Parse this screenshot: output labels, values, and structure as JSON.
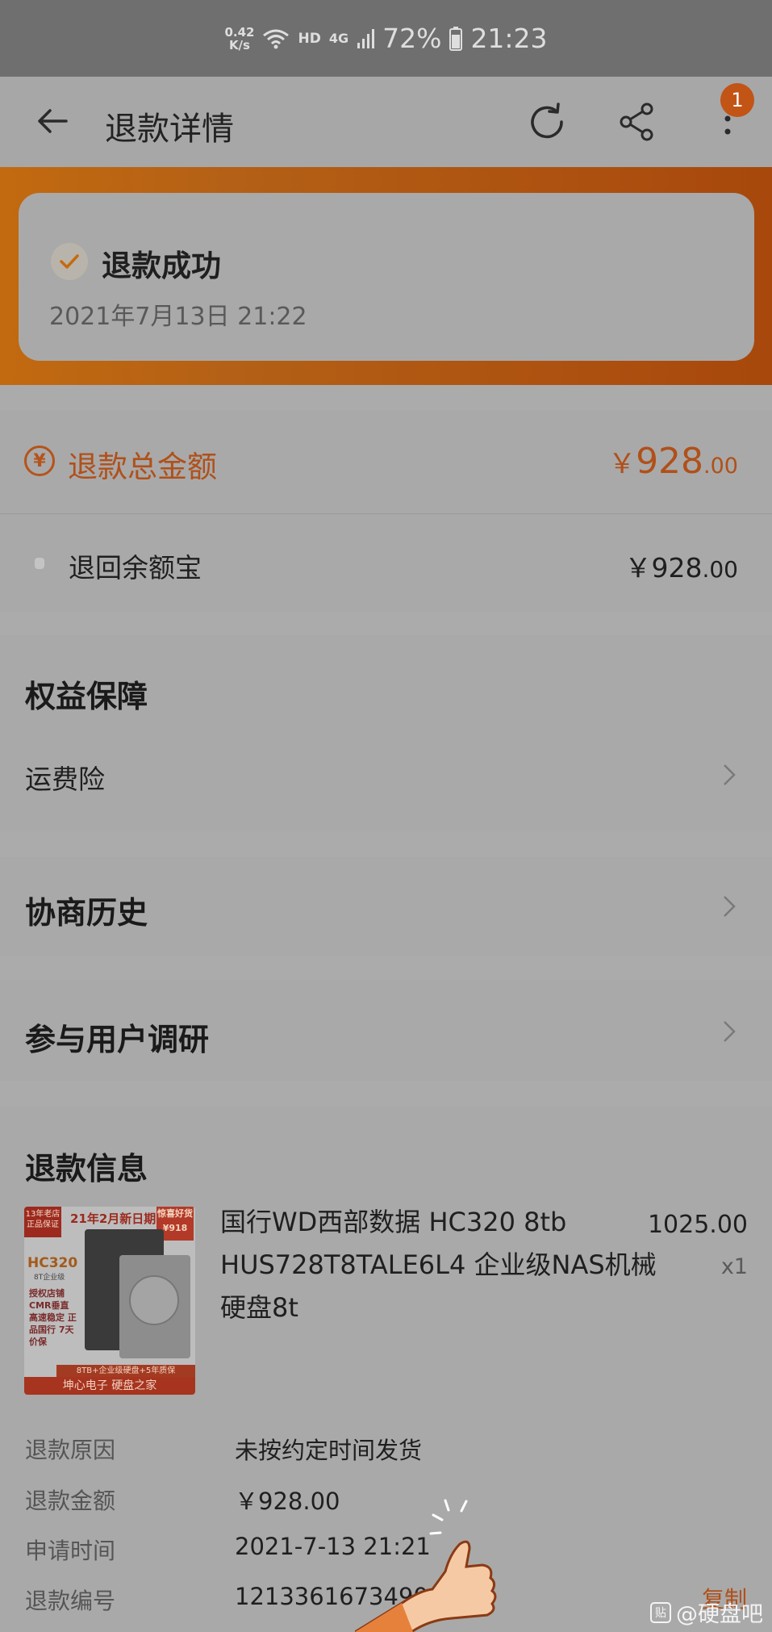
{
  "status_bar": {
    "speed_value": "0.42",
    "speed_unit": "K/s",
    "hd": "HD",
    "network": "4G",
    "battery": "72%",
    "time": "21:23"
  },
  "header": {
    "title": "退款详情",
    "notification_count": "1"
  },
  "status_card": {
    "status": "退款成功",
    "time": "2021年7月13日 21:22"
  },
  "refund_total": {
    "icon_glyph": "¥",
    "label": "退款总金额",
    "currency": "￥",
    "amount_int": "928",
    "amount_dec": ".00"
  },
  "refund_destination": {
    "label": "退回余额宝",
    "amount_main": "￥928",
    "amount_dec": ".00"
  },
  "benefits": {
    "title": "权益保障",
    "item": "运费险"
  },
  "negotiation_history": {
    "title": "协商历史"
  },
  "user_survey": {
    "title": "参与用户调研"
  },
  "refund_info": {
    "title": "退款信息",
    "product": {
      "title": "国行WD西部数据 HC320 8tb HUS728T8TALE6L4 企业级NAS机械硬盘8t",
      "price": "1025.00",
      "qty": "x1",
      "image": {
        "tag_store": "13年老店 正品保证",
        "new_date": "21年2月新日期",
        "price_label": "惊喜好货",
        "price": "¥918",
        "model": "HC320",
        "subtitle": "8T企业级",
        "features": "授权店铺 CMR垂直 高速稳定 正品国行 7天价保",
        "stripe": "8TB+企业级硬盘+5年质保",
        "footer": "坤心电子    硬盘之家"
      }
    },
    "rows": [
      {
        "label": "退款原因",
        "value": "未按约定时间发货"
      },
      {
        "label": "退款金额",
        "value": "￥928.00"
      },
      {
        "label": "申请时间",
        "value": "2021-7-13 21:21"
      },
      {
        "label": "退款编号",
        "value": "12133616734904"
      }
    ],
    "copy_label": "复制"
  },
  "watermark": {
    "icon": "贴",
    "text": "@硬盘吧"
  },
  "colors": {
    "accent": "#b0501a",
    "banner": "#b46016",
    "background": "#ababab",
    "card": "#a9a9a9"
  }
}
